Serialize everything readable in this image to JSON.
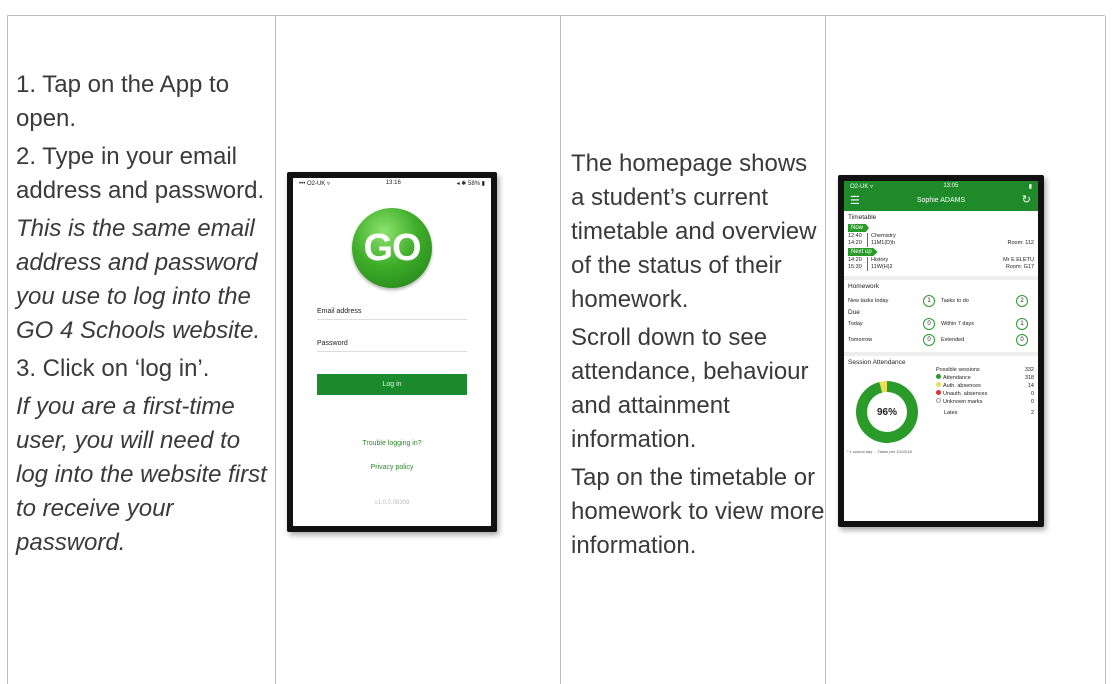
{
  "column1": {
    "lines": [
      {
        "text": "1. Tap on the App to open.",
        "italic": false
      },
      {
        "text": "2. Type in your email address and password.",
        "italic": false
      },
      {
        "text": "This is the same email address and password you use to log into the GO 4 Schools website.",
        "italic": true
      },
      {
        "text": "3. Click on ‘log in’.",
        "italic": false
      },
      {
        "text": "If you are a first-time user, you will need to log into the website first to receive your password.",
        "italic": true
      }
    ]
  },
  "login_screen": {
    "status_left": "••• O2-UK ▿",
    "status_time": "13:16",
    "status_right": "◂ ✱ 58% ▮",
    "logo_text": "GO",
    "email_label": "Email address",
    "password_label": "Password",
    "login_button": "Log in",
    "trouble_link": "Trouble logging in?",
    "privacy_link": "Privacy policy",
    "version": "v1.0.0.08309"
  },
  "column3": {
    "lines": [
      "The homepage shows a student’s current timetable and overview of the status of their homework.",
      "Scroll down to see attendance, behaviour and attainment information.",
      "Tap on the timetable or homework to view more information."
    ]
  },
  "home_screen": {
    "status_left": "O2-UK ▿",
    "status_time": "13:05",
    "status_right": "▮",
    "student_name": "Sophie ADAMS",
    "timetable_label": "Timetable",
    "now_tag": "Now",
    "now_lesson": {
      "start": "12:40",
      "end": "14:20",
      "subject": "Chemistry",
      "group": "11M1(D)h",
      "room": "Room: 112",
      "teacher": ""
    },
    "next_tag": "Next up",
    "next_lesson": {
      "start": "14:20",
      "end": "15:30",
      "subject": "History",
      "group": "11W(H)2",
      "room": "Room: G17",
      "teacher": "Mr E ELETU"
    },
    "homework_label": "Homework",
    "hw_new_label": "New tasks today",
    "hw_new": "1",
    "hw_todo_label": "Tasks to do",
    "hw_todo": "2",
    "due_label": "Due",
    "hw_today_label": "Today",
    "hw_today": "0",
    "hw_week_label": "Within 7 days",
    "hw_week": "1",
    "hw_tomorrow_label": "Tomorrow",
    "hw_tomorrow": "0",
    "hw_extended_label": "Extended",
    "hw_extended": "0",
    "attendance_label": "Session Attendance",
    "attendance_percent": "96%",
    "attendance_fraction": 0.96,
    "possible_label": "Possible sessions",
    "possible": "332",
    "att_rows": [
      {
        "label": "Attendance",
        "value": "318",
        "color": "#2a9a2a"
      },
      {
        "label": "Auth. absences",
        "value": "14",
        "color": "#e8e05a"
      },
      {
        "label": "Unauth. absences",
        "value": "0",
        "color": "#e03030"
      },
      {
        "label": "Unknown marks",
        "value": "0",
        "color": "#ffffff"
      }
    ],
    "lates_label": "Lates",
    "lates": "2",
    "footer": "* 1 school day ... Taken per 10/10/18"
  }
}
